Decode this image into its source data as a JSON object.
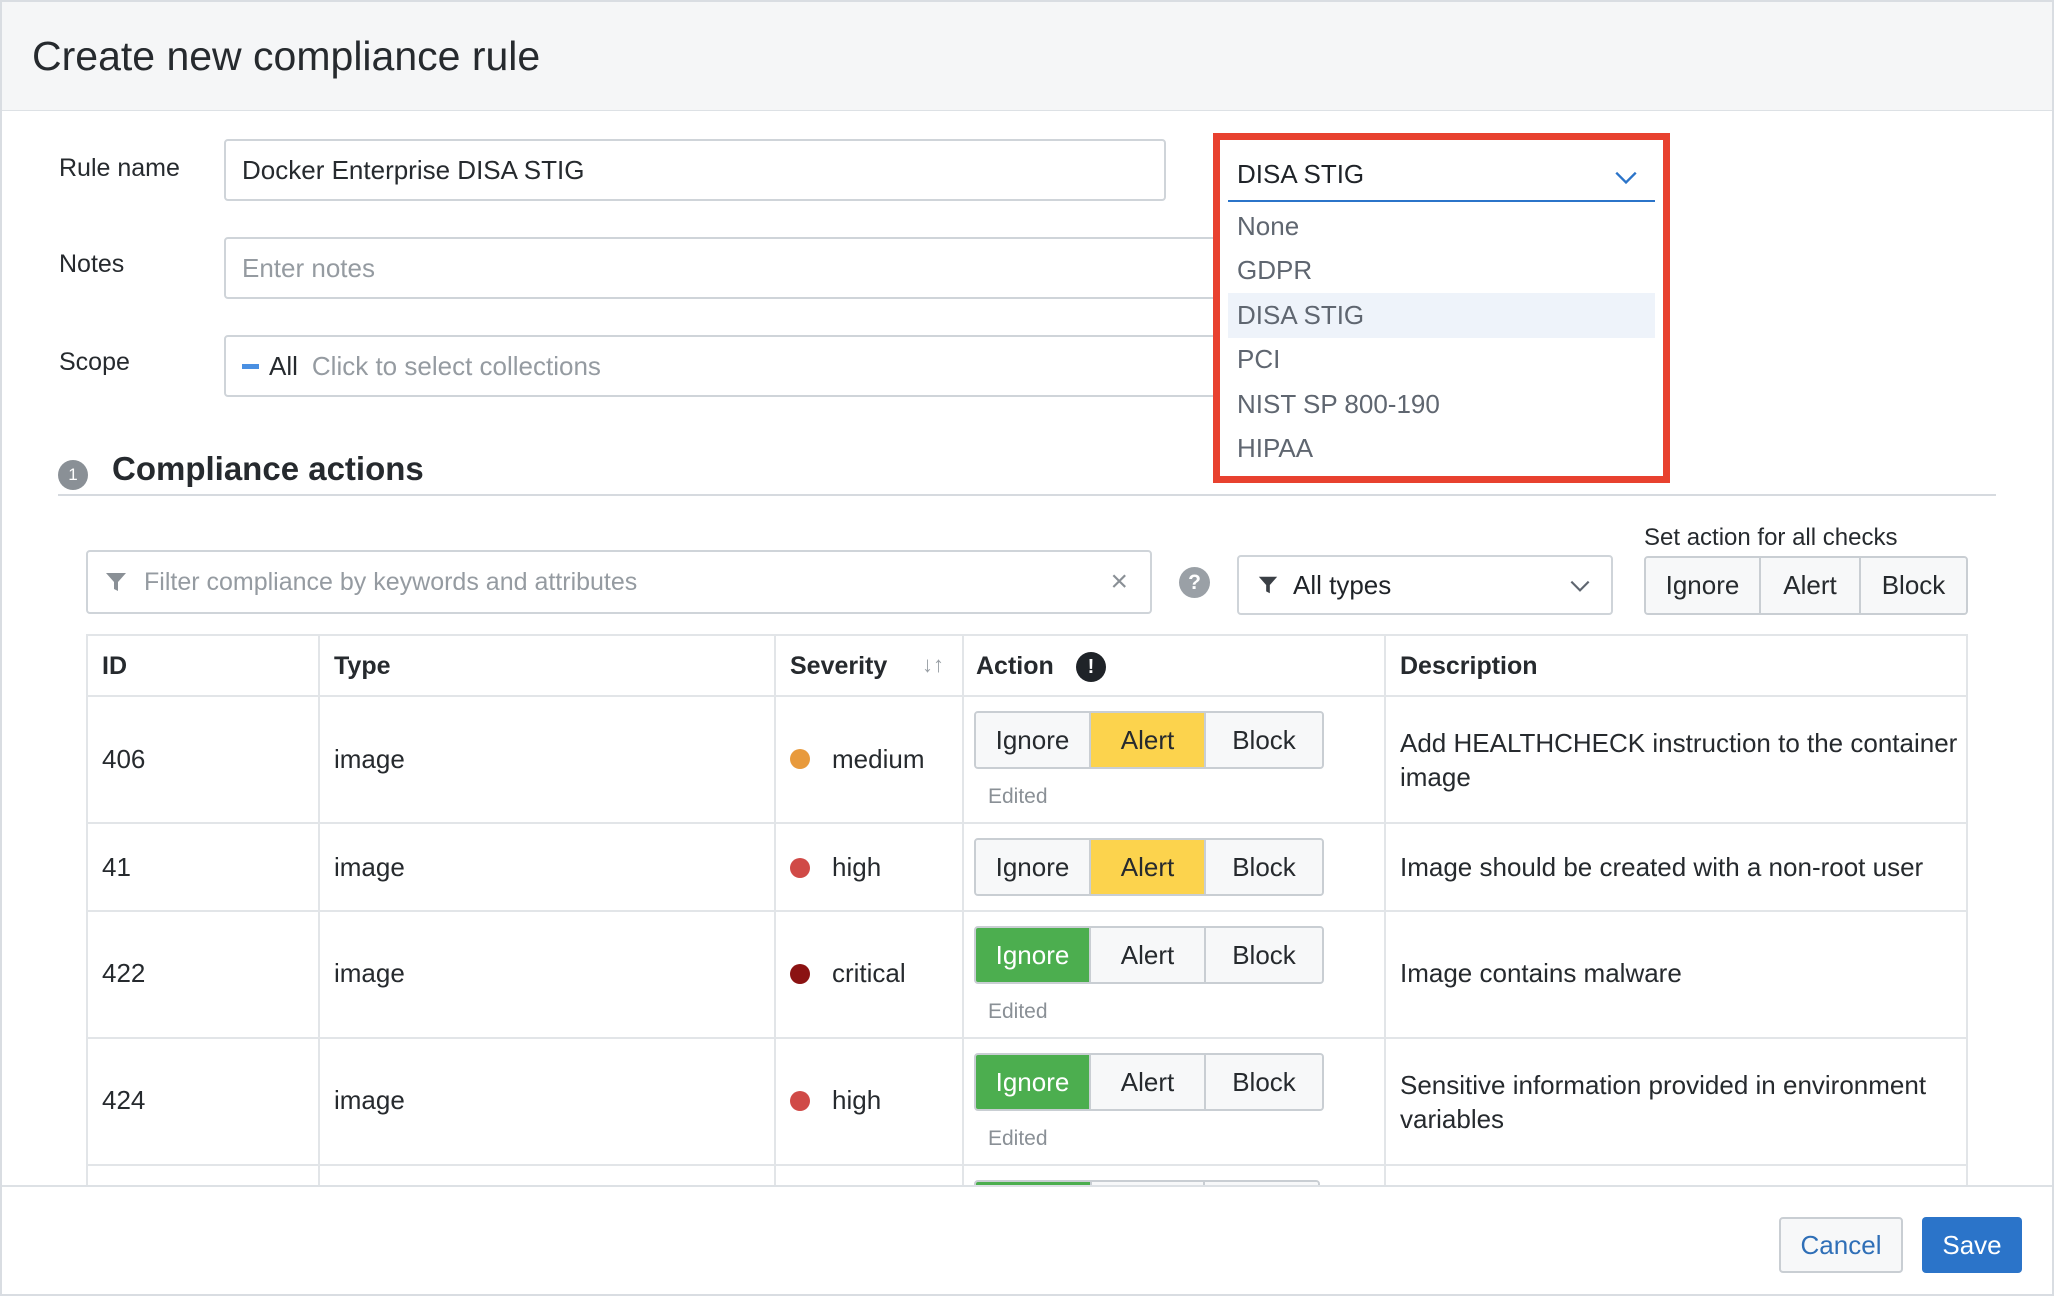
{
  "modal": {
    "title": "Create new compliance rule"
  },
  "form": {
    "rule_name_label": "Rule name",
    "rule_name_value": "Docker Enterprise DISA STIG",
    "notes_label": "Notes",
    "notes_placeholder": "Enter notes",
    "scope_label": "Scope",
    "scope_value": "All",
    "scope_placeholder": "Click to select collections"
  },
  "template_dropdown": {
    "selected": "DISA STIG",
    "options": [
      "None",
      "GDPR",
      "DISA STIG",
      "PCI",
      "NIST SP 800-190",
      "HIPAA"
    ]
  },
  "section": {
    "step": "1",
    "title": "Compliance actions"
  },
  "toolbar": {
    "filter_placeholder": "Filter compliance by keywords and attributes",
    "clear_symbol": "×",
    "help_symbol": "?",
    "type_filter": "All types",
    "set_all_label": "Set action for all checks",
    "set_all_actions": [
      "Ignore",
      "Alert",
      "Block"
    ]
  },
  "table": {
    "headers": [
      "ID",
      "Type",
      "Severity",
      "Action",
      "Description"
    ],
    "sort_symbol": "↓↑",
    "action_info_symbol": "!",
    "action_options": [
      "Ignore",
      "Alert",
      "Block"
    ],
    "edited_label": "Edited",
    "rows": [
      {
        "id": "406",
        "type": "image",
        "severity": "medium",
        "severity_color": "#e89a3c",
        "action": "Alert",
        "edited": true,
        "description": [
          "Add HEALTHCHECK instruction to the container",
          "image"
        ]
      },
      {
        "id": "41",
        "type": "image",
        "severity": "high",
        "severity_color": "#d04a47",
        "action": "Alert",
        "edited": false,
        "description": [
          "Image should be created with a non-root user"
        ]
      },
      {
        "id": "422",
        "type": "image",
        "severity": "critical",
        "severity_color": "#8b1212",
        "action": "Ignore",
        "edited": true,
        "description": [
          "Image contains malware"
        ]
      },
      {
        "id": "424",
        "type": "image",
        "severity": "high",
        "severity_color": "#d04a47",
        "action": "Ignore",
        "edited": true,
        "description": [
          "Sensitive information provided in environment",
          "variables"
        ]
      }
    ]
  },
  "footer": {
    "cancel_label": "Cancel",
    "save_label": "Save"
  },
  "colors": {
    "accent": "#2b74c9",
    "highlight_border": "#e8412f",
    "alert_active": "#fcd34d",
    "ignore_active": "#4cae4f"
  }
}
